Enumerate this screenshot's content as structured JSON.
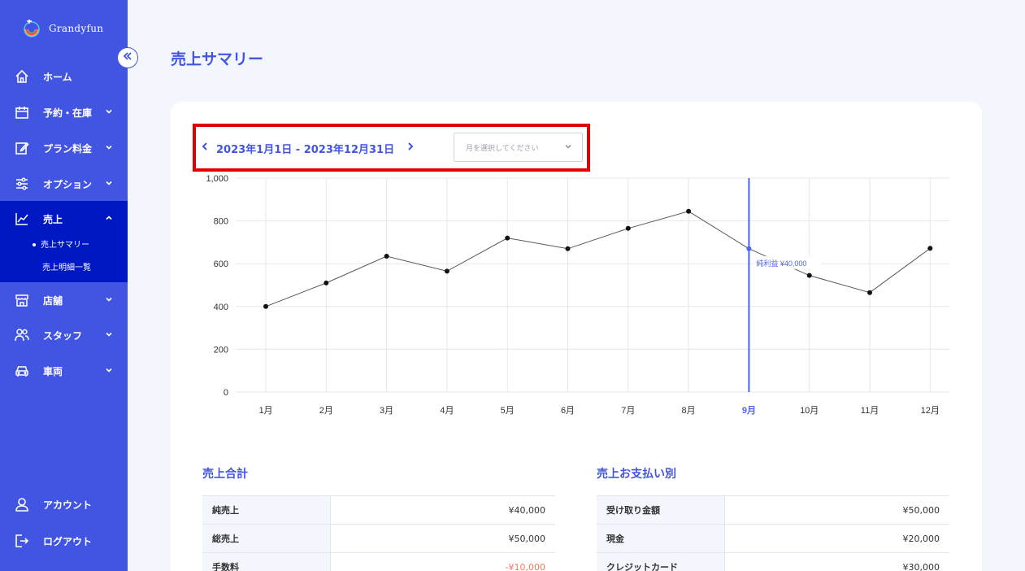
{
  "app": {
    "name": "Grandyfun"
  },
  "sidebar": {
    "collapse_icon": "double-chevron-left-icon",
    "items": [
      {
        "label": "ホーム",
        "icon": "home-icon"
      },
      {
        "label": "予約・在庫",
        "icon": "calendar-icon"
      },
      {
        "label": "プラン料金",
        "icon": "edit-icon"
      },
      {
        "label": "オプション",
        "icon": "sliders-icon"
      },
      {
        "label": "売上",
        "icon": "chart-line-icon"
      },
      {
        "label": "店舗",
        "icon": "store-icon"
      },
      {
        "label": "スタッフ",
        "icon": "users-icon"
      },
      {
        "label": "車両",
        "icon": "car-icon"
      }
    ],
    "sub_items": [
      {
        "label": "売上サマリー",
        "active": true
      },
      {
        "label": "売上明細一覧",
        "active": false
      }
    ],
    "account_label": "アカウント",
    "logout_label": "ログアウト"
  },
  "main": {
    "title": "売上サマリー",
    "date_range": "2023年1月1日 - 2023年12月31日",
    "month_select_placeholder": "月を選択してください"
  },
  "chart_data": {
    "type": "line",
    "categories": [
      "1月",
      "2月",
      "3月",
      "4月",
      "5月",
      "6月",
      "7月",
      "8月",
      "9月",
      "10月",
      "11月",
      "12月"
    ],
    "series": [
      {
        "name": "純利益",
        "values": [
          400,
          510,
          635,
          565,
          720,
          670,
          765,
          845,
          670,
          545,
          465,
          672
        ]
      }
    ],
    "ylim": [
      0,
      1000
    ],
    "yticks": [
      0,
      200,
      400,
      600,
      800,
      1000
    ],
    "ytick_labels": [
      "0",
      "200",
      "400",
      "600",
      "800",
      "1,000"
    ],
    "grid": true,
    "highlight_index": 8,
    "tooltip": {
      "label": "純利益",
      "value": "¥40,000"
    },
    "colors": {
      "line": "#555555",
      "highlight": "#4f63e6",
      "grid": "#e5e7eb"
    }
  },
  "sales_total": {
    "title": "売上合計",
    "rows": [
      {
        "label": "純売上",
        "value": "¥40,000",
        "negative": false
      },
      {
        "label": "総売上",
        "value": "¥50,000",
        "negative": false
      },
      {
        "label": "手数料",
        "value": "-¥10,000",
        "negative": true
      }
    ]
  },
  "sales_by_payment": {
    "title": "売上お支払い別",
    "rows": [
      {
        "label": "受け取り金額",
        "value": "¥50,000"
      },
      {
        "label": "現金",
        "value": "¥20,000"
      },
      {
        "label": "クレジットカード",
        "value": "¥30,000"
      }
    ]
  },
  "colors": {
    "brand": "#4254e2",
    "sidebar_active": "#0018c4",
    "highlight_box": "#e00000"
  }
}
